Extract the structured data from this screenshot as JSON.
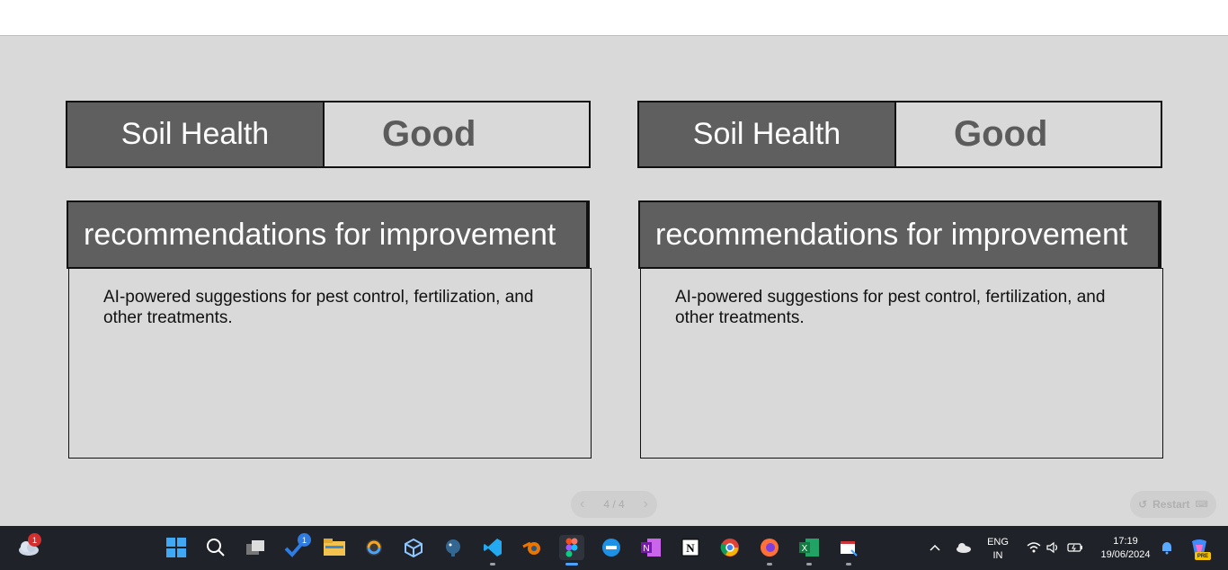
{
  "panels": [
    {
      "status_label": "Soil Health",
      "status_value": "Good",
      "reco_title": "recommendations for improvement",
      "reco_text": "AI-powered suggestions for pest control, fertilization, and other treatments."
    },
    {
      "status_label": "Soil Health",
      "status_value": "Good",
      "reco_title": "recommendations for improvement",
      "reco_text": "AI-powered suggestions for pest control, fertilization, and other treatments."
    }
  ],
  "pager": {
    "label": "4 / 4",
    "prev_icon": "chevron-left-icon",
    "next_icon": "chevron-right-icon"
  },
  "restart": {
    "label": "Restart",
    "icon": "restart-icon"
  },
  "taskbar": {
    "weather_badge": "1",
    "pinned_badge": "1",
    "language": "ENG",
    "region": "IN",
    "time": "17:19",
    "date": "19/06/2024",
    "copilot_badge": "PRE"
  },
  "colors": {
    "dark_box": "#5f5f5f",
    "canvas": "#d9d9d9",
    "taskbar": "#1f2228"
  }
}
